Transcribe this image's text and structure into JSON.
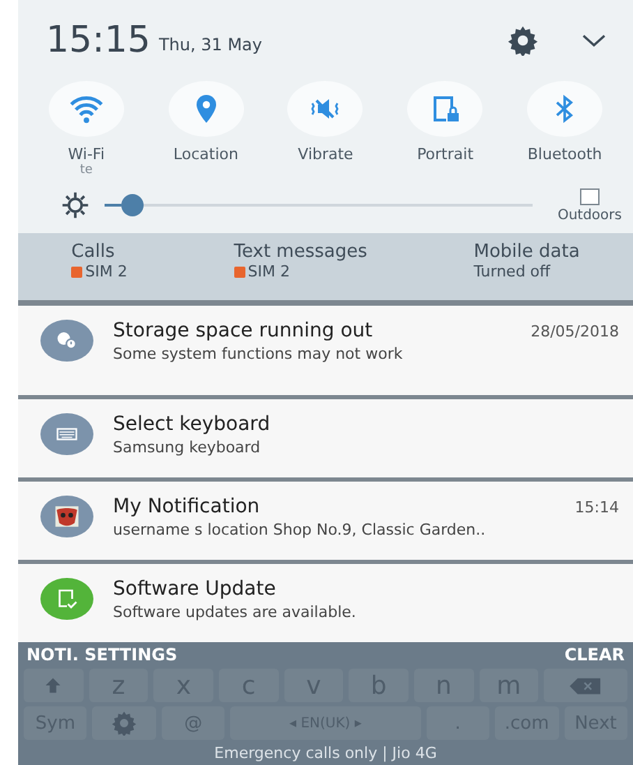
{
  "header": {
    "time": "15:15",
    "date": "Thu, 31 May"
  },
  "toggles": [
    {
      "kind": "wifi",
      "label": "Wi-Fi",
      "sub": "te"
    },
    {
      "kind": "location",
      "label": "Location"
    },
    {
      "kind": "vibrate",
      "label": "Vibrate"
    },
    {
      "kind": "portrait",
      "label": "Portrait"
    },
    {
      "kind": "bluetooth",
      "label": "Bluetooth"
    }
  ],
  "brightness": {
    "level": 0.04,
    "outdoors": {
      "label": "Outdoors",
      "checked": false
    }
  },
  "sim_bar": [
    {
      "title": "Calls",
      "value": "SIM 2",
      "sim": true
    },
    {
      "title": "Text messages",
      "value": "SIM 2",
      "sim": true
    },
    {
      "title": "Mobile data",
      "value": "Turned off",
      "sim": false
    }
  ],
  "notifications": [
    {
      "kind": "storage",
      "title": "Storage space running out",
      "time": "28/05/2018",
      "text": "Some system functions may not work"
    },
    {
      "kind": "keyboard",
      "title": "Select keyboard",
      "text": "Samsung keyboard"
    },
    {
      "kind": "app",
      "title": "My Notification",
      "time": "15:14",
      "text": "username s location Shop No.9, Classic Garden.."
    },
    {
      "kind": "update",
      "title": "Software Update",
      "text": "Software updates are available."
    }
  ],
  "actions": {
    "left": "NOTI. SETTINGS",
    "right": "CLEAR"
  },
  "keyboard": {
    "row_1": [
      {
        "kind": "shift"
      },
      {
        "kind": "key",
        "label": "z"
      },
      {
        "kind": "key",
        "label": "x"
      },
      {
        "kind": "key",
        "label": "c"
      },
      {
        "kind": "key",
        "label": "v"
      },
      {
        "kind": "key",
        "label": "b"
      },
      {
        "kind": "key",
        "label": "n"
      },
      {
        "kind": "key",
        "label": "m"
      },
      {
        "kind": "backspace"
      }
    ],
    "row_2": [
      {
        "kind": "key",
        "label": "Sym"
      },
      {
        "kind": "gear"
      },
      {
        "kind": "key",
        "label": "@"
      },
      {
        "kind": "space",
        "label": "◂ EN(UK) ▸"
      },
      {
        "kind": "key",
        "label": "."
      },
      {
        "kind": "key",
        "label": ".com"
      },
      {
        "kind": "key",
        "label": "Next"
      }
    ]
  },
  "carrier": "Emergency calls only | Jio 4G"
}
